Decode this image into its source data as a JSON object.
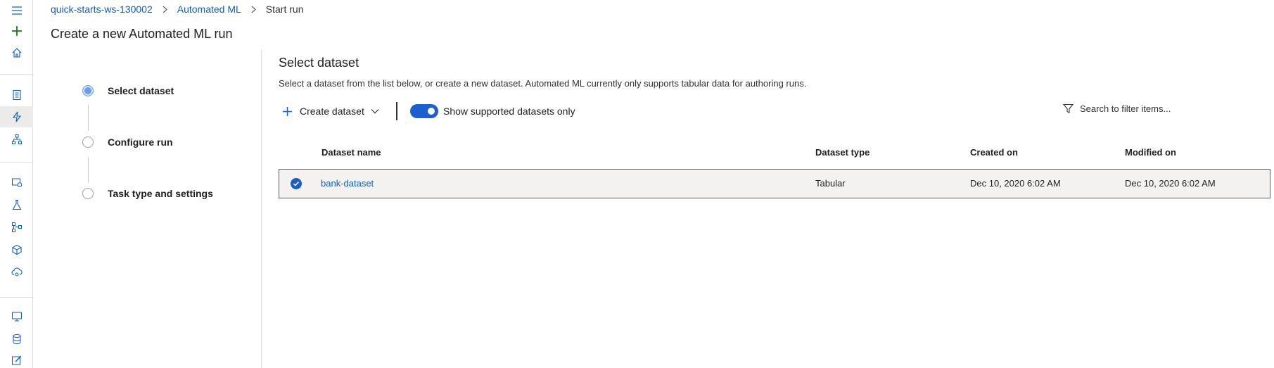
{
  "nav_rail": {
    "items": [
      "hamburger-icon",
      "plus-icon",
      "home-icon",
      "notebook-icon",
      "automl-icon",
      "designer-icon",
      "datasets-icon",
      "experiments-icon",
      "pipelines-icon",
      "models-icon",
      "endpoints-icon",
      "compute-icon",
      "datastores-icon",
      "labeling-icon"
    ],
    "active_item": "automl-icon",
    "accent_plus": "#107c10"
  },
  "breadcrumb": {
    "workspace": "quick-starts-ws-130002",
    "section": "Automated ML",
    "current": "Start run"
  },
  "page_title": "Create a new Automated ML run",
  "wizard": {
    "steps": [
      {
        "label": "Select dataset",
        "active": true
      },
      {
        "label": "Configure run",
        "active": false
      },
      {
        "label": "Task type and settings",
        "active": false
      }
    ]
  },
  "main": {
    "title": "Select dataset",
    "description": "Select a dataset from the list below, or create a new dataset. Automated ML currently only supports tabular data for authoring runs.",
    "create_button": "Create dataset",
    "toggle_label": "Show supported datasets only",
    "toggle_on": true,
    "filter_placeholder": "Search to filter items..."
  },
  "table": {
    "columns": [
      "Dataset name",
      "Dataset type",
      "Created on",
      "Modified on"
    ],
    "rows": [
      {
        "name": "bank-dataset",
        "type": "Tabular",
        "created": "Dec 10, 2020 6:02 AM",
        "modified": "Dec 10, 2020 6:02 AM",
        "selected": true
      }
    ]
  },
  "colors": {
    "link": "#0b5ec5",
    "toggle_on": "#1b5fd1",
    "selected_row_bg": "#f3f2f1"
  }
}
